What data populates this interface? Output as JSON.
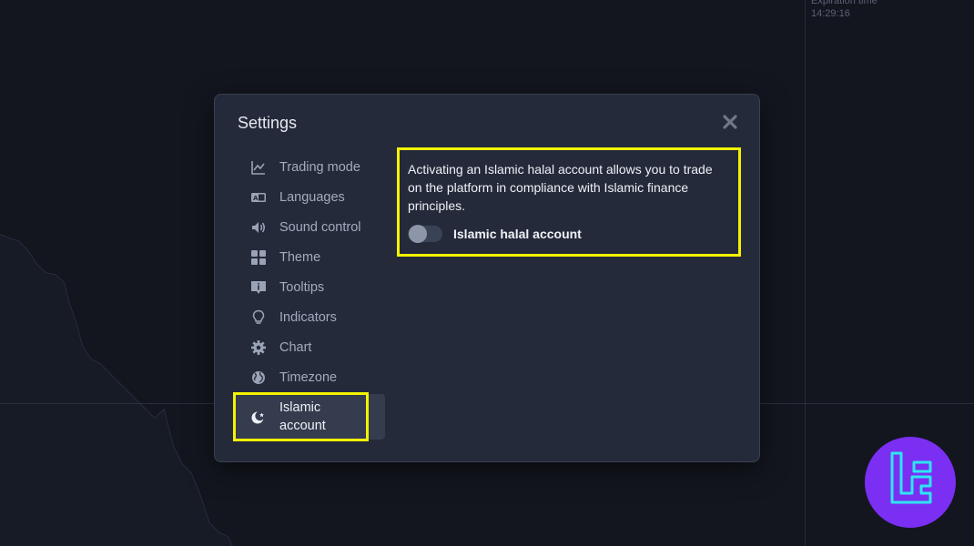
{
  "background": {
    "expiration_label": "Expiration time",
    "expiration_time": "14:29:16"
  },
  "modal": {
    "title": "Settings",
    "close_icon": "close-icon"
  },
  "menu": {
    "items": [
      {
        "label": "Trading mode",
        "icon": "chart-line-icon"
      },
      {
        "label": "Languages",
        "icon": "language-icon"
      },
      {
        "label": "Sound control",
        "icon": "speaker-icon"
      },
      {
        "label": "Theme",
        "icon": "grid-icon"
      },
      {
        "label": "Tooltips",
        "icon": "info-bubble-icon"
      },
      {
        "label": "Indicators",
        "icon": "lightbulb-icon"
      },
      {
        "label": "Chart",
        "icon": "gear-icon"
      },
      {
        "label": "Timezone",
        "icon": "globe-icon"
      }
    ],
    "active": {
      "label": "Islamic account",
      "icon": "crescent-star-icon"
    }
  },
  "islamic": {
    "description": "Activating an Islamic halal account allows you to trade on the platform in compliance with Islamic finance principles.",
    "toggle_label": "Islamic halal account",
    "toggle_on": false
  },
  "colors": {
    "highlight": "#f3f300",
    "logo": "#7b2ff2",
    "logo_accent": "#2ee6f2"
  }
}
